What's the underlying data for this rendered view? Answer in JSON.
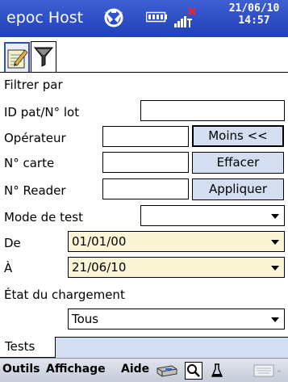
{
  "titlebar": {
    "app_title": "epoc Host",
    "date": "21/06/10",
    "time": "14:57"
  },
  "tabs": [
    {
      "name": "test-results-tab",
      "icon": "notepad-pencil-icon",
      "active": true
    },
    {
      "name": "filter-tab",
      "icon": "funnel-filter-icon",
      "active": false
    }
  ],
  "form": {
    "filter_by_label": "Filtrer par",
    "patient_id_label": "ID pat/N° lot",
    "patient_id_value": "",
    "operator_label": "Opérateur",
    "operator_value": "",
    "card_label": "N° carte",
    "card_value": "",
    "reader_label": "N° Reader",
    "reader_value": "",
    "less_button": "Moins <<",
    "clear_button": "Effacer",
    "apply_button": "Appliquer",
    "test_mode_label": "Mode de test",
    "test_mode_value": "",
    "from_label": "De",
    "from_value": "01/01/00",
    "to_label": "À",
    "to_value": "21/06/10",
    "upload_status_label": "État du chargement",
    "upload_status_value": "Tous",
    "tests_label": "Tests"
  },
  "menubar": {
    "tools": "Outils",
    "view": "Affichage",
    "help": "Aide"
  },
  "colors": {
    "titlebar": "#2f4fc6",
    "button": "#d3def0",
    "date_field": "#fbf5d5"
  }
}
